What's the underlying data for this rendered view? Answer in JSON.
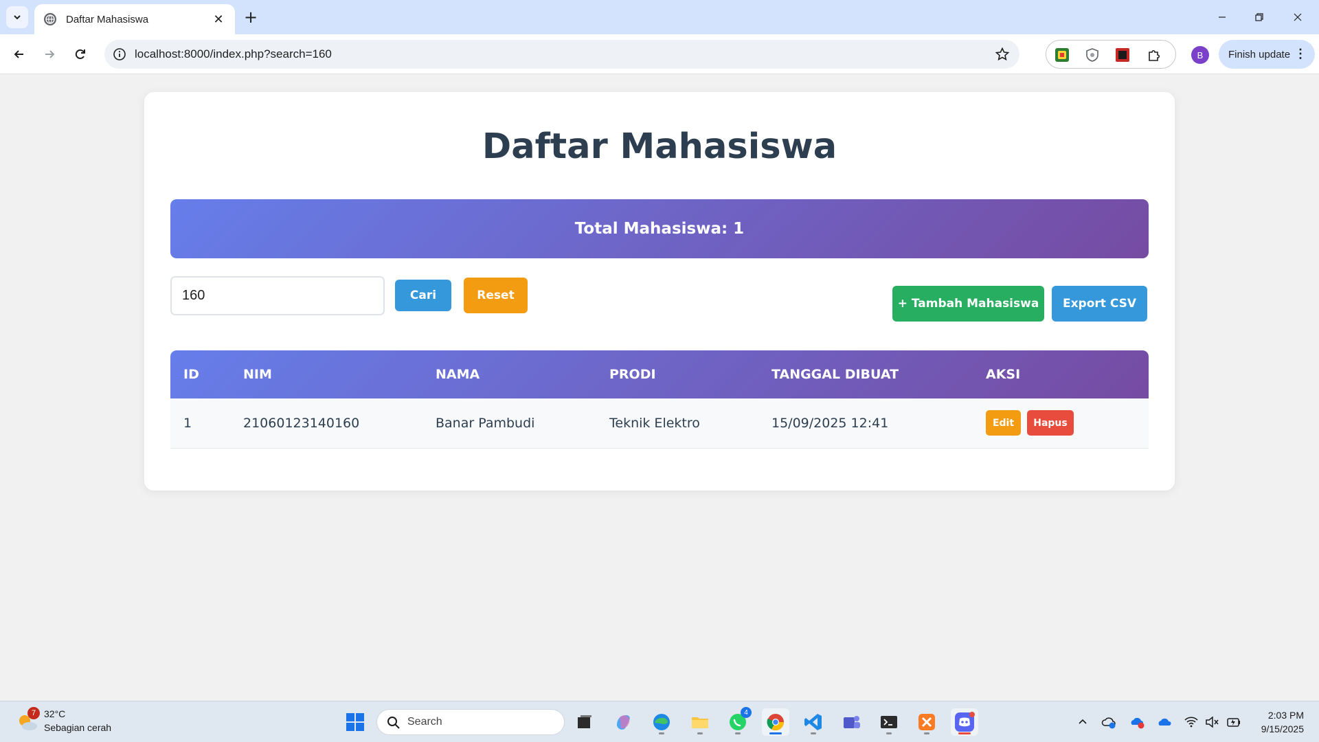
{
  "browser": {
    "tab_title": "Daftar Mahasiswa",
    "url": "localhost:8000/index.php?search=160",
    "finish_update_label": "Finish update",
    "profile_initial": "B"
  },
  "page": {
    "title": "Daftar Mahasiswa",
    "total_label": "Total Mahasiswa: 1",
    "search_value": "160",
    "search_button": "Cari",
    "reset_button": "Reset",
    "add_button": "+ Tambah Mahasiswa",
    "export_button": "Export CSV"
  },
  "table": {
    "headers": [
      "ID",
      "NIM",
      "NAMA",
      "PRODI",
      "TANGGAL DIBUAT",
      "AKSI"
    ],
    "rows": [
      {
        "id": "1",
        "nim": "21060123140160",
        "nama": "Banar Pambudi",
        "prodi": "Teknik Elektro",
        "tanggal": "15/09/2025 12:41",
        "edit_label": "Edit",
        "delete_label": "Hapus"
      }
    ]
  },
  "colors": {
    "gradient_start": "#667eea",
    "gradient_end": "#764ba2",
    "primary_blue": "#3498db",
    "orange": "#f39c12",
    "green": "#27ae60",
    "red": "#e74c3c",
    "title_color": "#2c3e50"
  },
  "taskbar": {
    "weather_temp": "32°C",
    "weather_desc": "Sebagian cerah",
    "weather_badge": "7",
    "search_label": "Search",
    "whatsapp_badge": "4",
    "time": "2:03 PM",
    "date": "9/15/2025"
  }
}
